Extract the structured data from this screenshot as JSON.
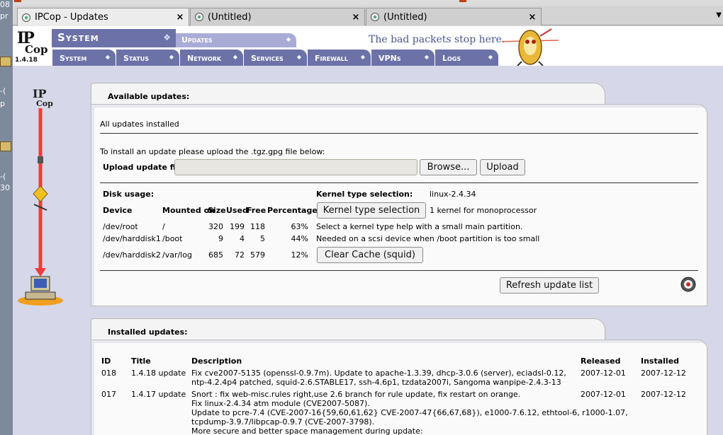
{
  "desktop_fragments": [
    "08",
    "pr",
    "-(",
    "p",
    "-(",
    "30"
  ],
  "tabs": [
    {
      "label": "IPCop - Updates",
      "active": true
    },
    {
      "label": "(Untitled)",
      "active": false
    },
    {
      "label": "(Untitled)",
      "active": false
    }
  ],
  "tab_close": "×",
  "tab_more": "▼",
  "logo": {
    "line1": "IP",
    "line2": "Cop",
    "version": "1.4.18"
  },
  "header": {
    "section": "System",
    "subpage": "Updates",
    "slogan": "The bad packets stop here."
  },
  "nav": [
    "System",
    "Status",
    "Network",
    "Services",
    "Firewall",
    "VPNs",
    "Logs"
  ],
  "available": {
    "title": "Available updates:",
    "status": "All updates installed",
    "instruction": "To install an update please upload the .tgz.gpg file below:",
    "upload_label": "Upload update file:",
    "upload_value": "",
    "browse_label": "Browse...",
    "upload_button": "Upload",
    "disk_usage_title": "Disk usage:",
    "disk_headers": [
      "Device",
      "Mounted on",
      "Size",
      "Used",
      "Free",
      "Percentage"
    ],
    "disks": [
      {
        "device": "/dev/root",
        "mount": "/",
        "size": "320",
        "used": "199",
        "free": "118",
        "pct": "63%"
      },
      {
        "device": "/dev/harddisk1",
        "mount": "/boot",
        "size": "9",
        "used": "4",
        "free": "5",
        "pct": "44%"
      },
      {
        "device": "/dev/harddisk2",
        "mount": "/var/log",
        "size": "685",
        "used": "72",
        "free": "579",
        "pct": "12%"
      }
    ],
    "kernel_label": "Kernel type selection:",
    "kernel_value": "linux-2.4.34",
    "kernel_button": "Kernel type selection",
    "kernel_info": "1 kernel for monoprocessor",
    "kernel_help1": "Select a kernel type help with a small main partition.",
    "kernel_help2": "Needed on a scsi device when /boot partition is too small",
    "clear_cache_button": "Clear Cache (squid)",
    "refresh_button": "Refresh update list"
  },
  "installed": {
    "title": "Installed updates:",
    "headers": [
      "ID",
      "Title",
      "Description",
      "Released",
      "Installed"
    ],
    "rows": [
      {
        "id": "018",
        "title": "1.4.18 update",
        "desc": [
          "Fix cve2007-5135 (openssl-0.9.7m). Update to apache-1.3.39, dhcp-3.0.6 (server), eciadsl-0.12,",
          "ntp-4.2.4p4 patched, squid-2.6.STABLE17, ssh-4.6p1, tzdata2007i, Sangoma wanpipe-2.4.3-13"
        ],
        "released": "2007-12-01",
        "installed": "2007-12-12"
      },
      {
        "id": "017",
        "title": "1.4.17 update",
        "desc": [
          "Snort : fix web-misc.rules right,use 2.6 branch for rule update, fix restart on orange.",
          "Fix linux-2.4.34 atm module (CVE2007-5087).",
          "Update to pcre-7.4 (CVE-2007-16{59,60,61,62} CVE-2007-47{66,67,68}), e1000-7.6.12, ethtool-6, r1000-1.07,",
          "tcpdump-3.9.7/libpcap-0.9.7 (CVE-2007-3798).",
          "More secure and better space management during update:"
        ],
        "released": "2007-12-01",
        "installed": "2007-12-12"
      }
    ]
  },
  "colors": {
    "nav": "#6c72a8",
    "page_bg": "#d6d7e8",
    "arrow": "#f03c3c"
  }
}
